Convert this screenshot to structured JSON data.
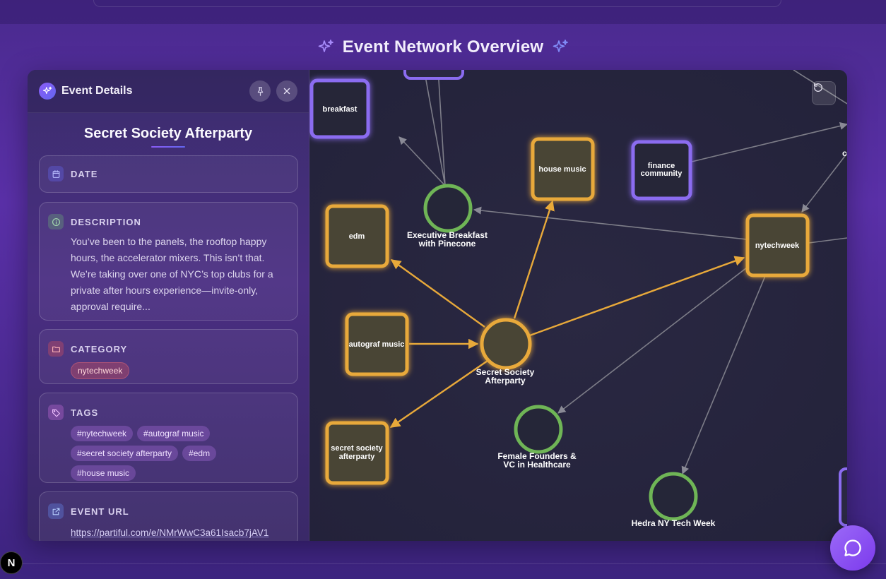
{
  "page": {
    "title": "Event Network Overview"
  },
  "panel": {
    "header_title": "Event Details",
    "event_title": "Secret Society Afterparty",
    "date": {
      "label": "DATE",
      "value": ""
    },
    "description": {
      "label": "DESCRIPTION",
      "text": "You’ve been to the panels, the rooftop happy hours, the accelerator mixers. This isn’t that. We’re taking over one of NYC’s top clubs for a private after hours experience—invite-only, approval require..."
    },
    "category": {
      "label": "CATEGORY",
      "value": "nytechweek"
    },
    "tags": {
      "label": "TAGS",
      "items": [
        "#nytechweek",
        "#autograf music",
        "#secret society afterparty",
        "#edm",
        "#house music"
      ]
    },
    "url": {
      "label": "EVENT URL",
      "value": "https://partiful.com/e/NMrWwC3a61Isacb7jAV1"
    }
  },
  "graph": {
    "nodes": [
      {
        "id": "breakfast",
        "label": "breakfast",
        "kind": "tag",
        "color": "#8b6cf0"
      },
      {
        "id": "house",
        "label": "house music",
        "kind": "category",
        "color": "#e8a93a"
      },
      {
        "id": "finance",
        "label": "finance community",
        "kind": "tag",
        "color": "#8b6cf0"
      },
      {
        "id": "edm",
        "label": "edm",
        "kind": "category",
        "color": "#e8a93a"
      },
      {
        "id": "nytechweek",
        "label": "nytechweek",
        "kind": "category",
        "color": "#e8a93a"
      },
      {
        "id": "autograf",
        "label": "autograf music",
        "kind": "category",
        "color": "#e8a93a"
      },
      {
        "id": "sspill",
        "label": "secret society afterparty",
        "kind": "category",
        "color": "#e8a93a"
      },
      {
        "id": "exec",
        "label": "Executive Breakfast with Pinecone",
        "kind": "event",
        "color": "#6fb556"
      },
      {
        "id": "ssa",
        "label": "Secret Society Afterparty",
        "kind": "event-selected",
        "color": "#e8a93a"
      },
      {
        "id": "female",
        "label": "Female Founders & VC in Healthcare",
        "kind": "event",
        "color": "#6fb556"
      },
      {
        "id": "hedra",
        "label": "Hedra NY Tech Week",
        "kind": "event",
        "color": "#6fb556"
      }
    ]
  },
  "chat": {
    "icon": "chat-bubble-icon"
  },
  "colors": {
    "accent": "#8b5cf6",
    "highlight_edge": "#e8a93a",
    "event_node": "#6fb556",
    "tag_node": "#8b6cf0"
  }
}
